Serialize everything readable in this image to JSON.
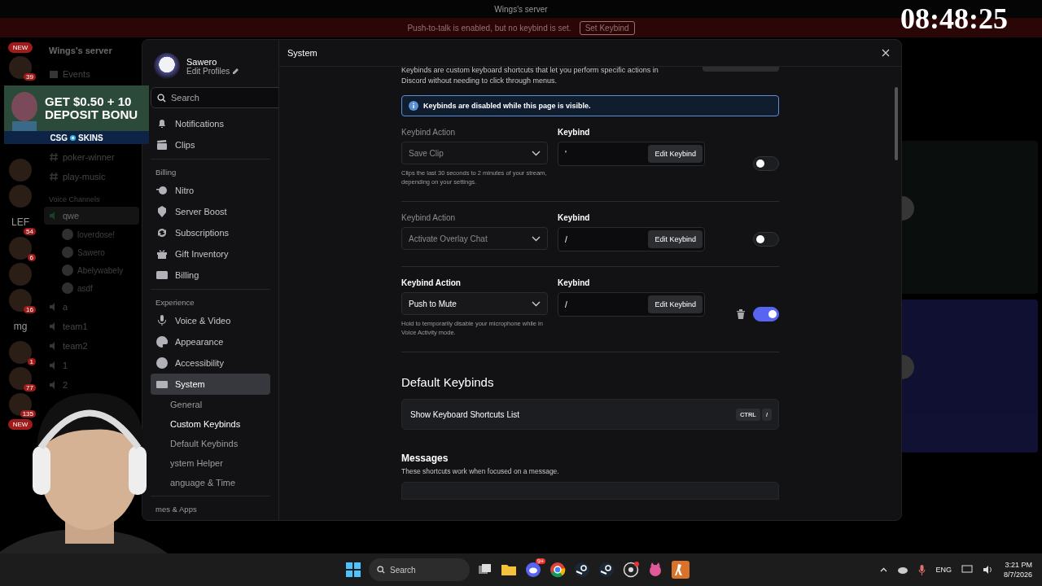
{
  "window": {
    "title": "Wings's server"
  },
  "notice": {
    "text": "Push-to-talk is enabled, but no keybind is set.",
    "button": "Set Keybind"
  },
  "server_rail": {
    "top_pill": "NEW",
    "items": [
      {
        "kind": "avatar",
        "badge": "39"
      },
      {
        "kind": "avatar"
      },
      {
        "kind": "avatar"
      },
      {
        "kind": "text",
        "label": "LEF",
        "badge": "54"
      },
      {
        "kind": "avatar",
        "badge": "6"
      },
      {
        "kind": "avatar"
      },
      {
        "kind": "avatar",
        "badge": "16"
      },
      {
        "kind": "text",
        "label": "mg"
      },
      {
        "kind": "avatar",
        "badge": "1"
      },
      {
        "kind": "avatar",
        "badge": "77"
      },
      {
        "kind": "avatar",
        "badge": "135"
      },
      {
        "kind": "pill",
        "label": "NEW"
      }
    ]
  },
  "channel_sidebar": {
    "server_name": "Wings's server",
    "items": [
      {
        "kind": "event",
        "label": "Events",
        "selected": false
      },
      {
        "kind": "text",
        "label": "poker-winner",
        "selected": false
      },
      {
        "kind": "text",
        "label": "play-music",
        "selected": false
      },
      {
        "kind": "category",
        "label": "Voice Channels"
      },
      {
        "kind": "voice",
        "label": "qwe",
        "selected": true,
        "children": [
          {
            "label": "loverdose!"
          },
          {
            "label": "Sawero"
          },
          {
            "label": "Abelywabely"
          },
          {
            "label": "asdf"
          }
        ]
      },
      {
        "kind": "voice",
        "label": "a",
        "selected": false
      },
      {
        "kind": "voice",
        "label": "team1",
        "selected": false
      },
      {
        "kind": "voice",
        "label": "team2",
        "selected": false
      },
      {
        "kind": "voice",
        "label": "1",
        "selected": false
      },
      {
        "kind": "voice",
        "label": "2",
        "selected": false
      }
    ]
  },
  "settings_dialog": {
    "profile": {
      "name": "Sawero",
      "link": "Edit Profiles"
    },
    "search": {
      "placeholder": "Search"
    },
    "nav": [
      {
        "kind": "item",
        "label": "Notifications",
        "selected": false
      },
      {
        "kind": "item",
        "label": "Clips",
        "selected": false
      },
      {
        "kind": "heading",
        "label": "Billing"
      },
      {
        "kind": "item",
        "label": "Nitro",
        "selected": false
      },
      {
        "kind": "item",
        "label": "Server Boost",
        "selected": false
      },
      {
        "kind": "item",
        "label": "Subscriptions",
        "selected": false
      },
      {
        "kind": "item",
        "label": "Gift Inventory",
        "selected": false
      },
      {
        "kind": "item",
        "label": "Billing",
        "selected": false
      },
      {
        "kind": "heading",
        "label": "Experience"
      },
      {
        "kind": "item",
        "label": "Voice & Video",
        "selected": false
      },
      {
        "kind": "item",
        "label": "Appearance",
        "selected": false
      },
      {
        "kind": "item",
        "label": "Accessibility",
        "selected": false
      },
      {
        "kind": "item",
        "label": "System",
        "selected": true
      },
      {
        "kind": "subitem",
        "label": "General",
        "selected": false
      },
      {
        "kind": "subitem",
        "label": "Custom Keybinds",
        "selected": true
      },
      {
        "kind": "subitem",
        "label": "Default Keybinds",
        "selected": false
      },
      {
        "kind": "subitem",
        "label": "ystem Helper",
        "selected": false
      },
      {
        "kind": "subitem",
        "label": "anguage & Time",
        "selected": false
      },
      {
        "kind": "heading",
        "label": "mes & Apps"
      }
    ],
    "title": "System",
    "intro": "Keybinds are custom keyboard shortcuts that let you perform specific actions in Discord without needing to click through menus.",
    "info": "Keybinds are disabled while this page is visible.",
    "keybinds": [
      {
        "action_label": "Keybind Action",
        "keybind_label": "Keybind",
        "action": "Save Clip",
        "keybind": "'",
        "button": "Edit Keybind",
        "description": "Clips the last 30 seconds to 2 minutes of your stream, depending on your settings.",
        "enabled": false,
        "deletable": false
      },
      {
        "action_label": "Keybind Action",
        "keybind_label": "Keybind",
        "action": "Activate Overlay Chat",
        "keybind": "/",
        "button": "Edit Keybind",
        "enabled": false,
        "deletable": false
      },
      {
        "action_label": "Keybind Action",
        "keybind_label": "Keybind",
        "action": "Push to Mute",
        "keybind": "/",
        "button": "Edit Keybind",
        "description": "Hold to temporarily disable your microphone while in Voice Activity mode.",
        "enabled": true,
        "deletable": true
      }
    ],
    "default_keybinds": {
      "title": "Default Keybinds",
      "rows": [
        {
          "label": "Show Keyboard Shortcuts List",
          "keys": [
            "CTRL",
            "/"
          ]
        }
      ]
    },
    "messages": {
      "title": "Messages",
      "subtitle": "These shortcuts work when focused on a message."
    }
  },
  "overlays": {
    "ad": {
      "line1": "GET $0.50 + 10",
      "line2": "DEPOSIT BONU",
      "brand_left": "CSG",
      "brand_right": "SKINS"
    },
    "timer": "08:48:25"
  },
  "taskbar": {
    "search": "Search",
    "apps": [
      {
        "kind": "task-view"
      },
      {
        "kind": "folder"
      },
      {
        "kind": "chat",
        "badge": "9+"
      },
      {
        "kind": "browser"
      },
      {
        "kind": "steam"
      },
      {
        "kind": "steam"
      },
      {
        "kind": "record"
      },
      {
        "kind": "mascot"
      },
      {
        "kind": "game"
      }
    ],
    "language": "ENG",
    "time": "3:21 PM",
    "date": "8/7/2026"
  }
}
